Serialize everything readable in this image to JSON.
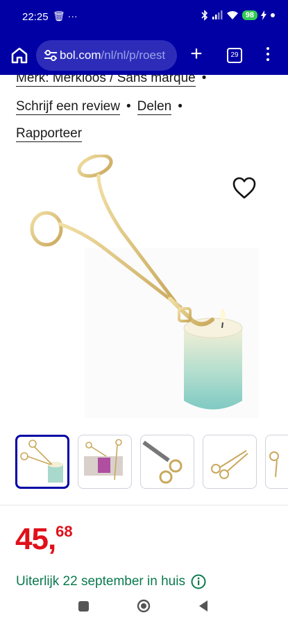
{
  "status_bar": {
    "time": "22:25",
    "left_icons": "🗑 ···",
    "battery": "98",
    "icons": [
      "bluetooth-icon",
      "signal-icon",
      "wifi-icon",
      "battery-icon",
      "charging-icon"
    ]
  },
  "browser": {
    "url_domain": "bol.com",
    "url_path": "/nl/nl/p/roest",
    "tab_count": "29",
    "new_tab_label": "+"
  },
  "product": {
    "brand_line": "Merk: Merkloos / Sans marque",
    "separator": "•",
    "actions": [
      "Schrijf een review",
      "Delen",
      "Rapporteer"
    ],
    "image_subject": "candle-wick-trimmer-gold",
    "thumbnail_count": 5,
    "price_euros": "45,",
    "price_cents": "68",
    "delivery": "Uiterlijk 22 september in huis"
  },
  "colors": {
    "brand_blue": "#0000a4",
    "price_red": "#e0101a",
    "delivery_green": "#0a7a4d"
  }
}
